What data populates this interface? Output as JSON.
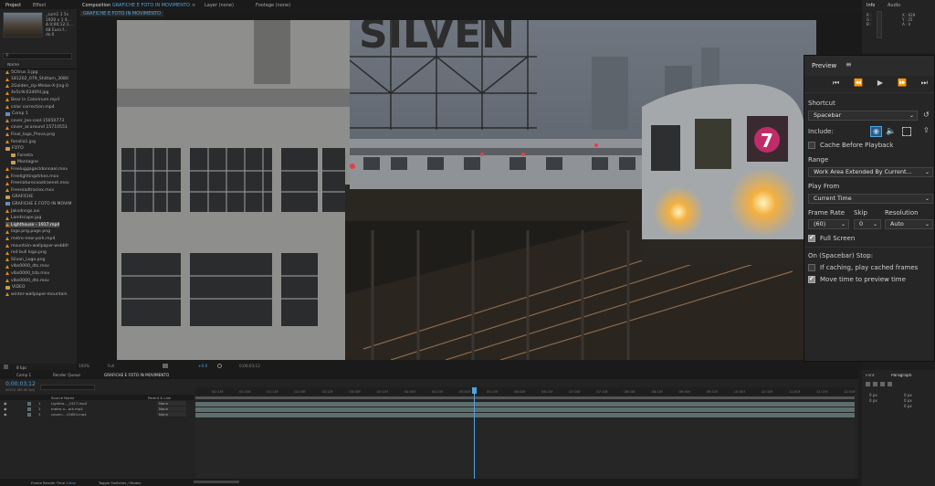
{
  "app": {
    "top_tabs": [
      "Project",
      "Effect",
      "Composition",
      "Layer (none)",
      "Footage (none)"
    ],
    "composition_tab": "GRAFICHE E FOTO IN MOVIMENTO",
    "composition_breadcrumb": "GRAFICHE E FOTO IN MOVIMENTO"
  },
  "project": {
    "title": "Project",
    "thumb_info": [
      "_sum1 1 5s",
      "1920 x 1 4...",
      "Δ 0;00;12;1...",
      "48 Euro f...",
      "ds.0"
    ],
    "search_placeholder": "",
    "column_name": "Name",
    "items": [
      {
        "label": "5Citrus 3.jpg",
        "kind": "cone",
        "indent": 0
      },
      {
        "label": "181202_079_Shittam_3080",
        "kind": "cone",
        "indent": 0
      },
      {
        "label": "2Golden_zip-Melan-X-Jing-0",
        "kind": "cone",
        "indent": 0
      },
      {
        "label": "4e5c9c02d0fd.jpg",
        "kind": "cone",
        "indent": 0
      },
      {
        "label": "Bear in Colorinum.mp4",
        "kind": "cone",
        "indent": 0
      },
      {
        "label": "color correction.mp4",
        "kind": "cone",
        "indent": 0
      },
      {
        "label": "Comp 1",
        "kind": "comp",
        "indent": 0
      },
      {
        "label": "cover_Joe-cool-15650773",
        "kind": "cone",
        "indent": 0
      },
      {
        "label": "cover_ar.around 15710551",
        "kind": "cone",
        "indent": 0
      },
      {
        "label": "Final_logo_Prova.png",
        "kind": "cone",
        "indent": 0
      },
      {
        "label": "fonolia1.jpg",
        "kind": "cone",
        "indent": 0
      },
      {
        "label": "FOTO",
        "kind": "folder",
        "indent": 0
      },
      {
        "label": "Foresta",
        "kind": "folder",
        "indent": 1
      },
      {
        "label": "Montagne",
        "kind": "folder",
        "indent": 1
      },
      {
        "label": "Freeluggagecldonnael.mov",
        "kind": "cone",
        "indent": 0
      },
      {
        "label": "Freelightingstrkes.mov",
        "kind": "cone",
        "indent": 0
      },
      {
        "label": "Freenaturecoastraenet.mov",
        "kind": "cone",
        "indent": 0
      },
      {
        "label": "Freeroadtraciex.mov",
        "kind": "cone",
        "indent": 0
      },
      {
        "label": "GRAFICHE",
        "kind": "folder",
        "indent": 0
      },
      {
        "label": "GRAFICHE E FOTO IN MOVIM",
        "kind": "comp",
        "indent": 0
      },
      {
        "label": "Jaksdnngs.avi",
        "kind": "cone",
        "indent": 0
      },
      {
        "label": "Landscape.jpg",
        "kind": "cone",
        "indent": 0
      },
      {
        "label": "Lighthouse - 1917.mp4",
        "kind": "cone",
        "indent": 0,
        "selected": true
      },
      {
        "label": "logo.png.page.png",
        "kind": "cone",
        "indent": 0
      },
      {
        "label": "metro-new-york.mp4",
        "kind": "cone",
        "indent": 0
      },
      {
        "label": "mountain-wallpaper-wxbbfr",
        "kind": "cone",
        "indent": 0
      },
      {
        "label": "red bull logo.png",
        "kind": "cone",
        "indent": 0
      },
      {
        "label": "Silvan_Logo.png",
        "kind": "cone",
        "indent": 0
      },
      {
        "label": "vlbs0000_dts.mov",
        "kind": "cone",
        "indent": 0
      },
      {
        "label": "vlbs0000_tda.mov",
        "kind": "cone",
        "indent": 0
      },
      {
        "label": "vlbs0000_dts.mov",
        "kind": "cone",
        "indent": 0
      },
      {
        "label": "VIDEO",
        "kind": "folder",
        "indent": 0
      },
      {
        "label": "winter-wallpaper-mountain",
        "kind": "cone",
        "indent": 0
      }
    ],
    "footer_bpc": "8 bpc"
  },
  "info_panel": {
    "tabs": [
      "Info",
      "Audio"
    ],
    "values": [
      "X : 629",
      "Y : 25",
      "R :",
      "G :",
      "B :",
      "A : 0"
    ],
    "audio_values": [
      "0.0",
      "-6.0",
      "-12.0",
      "-18.0",
      "-24.0"
    ]
  },
  "viewer": {
    "zoom": "100%",
    "quality": "Full",
    "timecode": "0;00;03;12",
    "exposure": "+0.0"
  },
  "preview": {
    "title": "Preview",
    "shortcut_label": "Shortcut",
    "shortcut_value": "Spacebar",
    "include_label": "Include:",
    "cache_before_playback": "Cache Before Playback",
    "cache_before_playback_checked": false,
    "range_label": "Range",
    "range_value": "Work Area Extended By Current...",
    "play_from_label": "Play From",
    "play_from_value": "Current Time",
    "frame_rate_label": "Frame Rate",
    "frame_rate_value": "(60)",
    "skip_label": "Skip",
    "skip_value": "0",
    "resolution_label": "Resolution",
    "resolution_value": "Auto",
    "full_screen": "Full Screen",
    "full_screen_checked": true,
    "on_stop_label": "On (Spacebar) Stop:",
    "if_caching": "If caching, play cached frames",
    "if_caching_checked": false,
    "move_time": "Move time to preview time",
    "move_time_checked": true
  },
  "timeline": {
    "tabs": [
      "Comp 1",
      "Render Queue",
      "GRAFICHE E FOTO IN MOVIMENTO"
    ],
    "timecode": "0;00;03;12",
    "timecode_sub": "00212 (60.00 fps)",
    "col_headers": {
      "source_name": "Source Name",
      "parent": "Parent & Link"
    },
    "layers": [
      {
        "num": "1",
        "name": "Lightho..._1917.mp4",
        "parent": "None"
      },
      {
        "num": "2",
        "name": "metro-n...ork.mp4",
        "parent": "None"
      },
      {
        "num": "3",
        "name": "coverr-...15650.mp4",
        "parent": "None"
      }
    ],
    "ticks": [
      "00:15f",
      "01:00f",
      "01:15f",
      "02:00f",
      "02:15f",
      "03:00f",
      "03:15f",
      "04:00f",
      "04:15f",
      "05:00f",
      "05:15f",
      "06:00f",
      "06:15f",
      "07:00f",
      "07:15f",
      "08:00f",
      "08:15f",
      "09:00f",
      "09:15f",
      "10:00f",
      "10:15f",
      "11:00f",
      "11:15f",
      "12:00f"
    ],
    "footer_render_time_label": "Frame Render Time",
    "footer_render_time": "14ms",
    "toggle_switches": "Toggle Switches / Modes"
  },
  "para_panel": {
    "tabs": [
      "Font",
      "Paragraph"
    ],
    "values": [
      "0 px",
      "0 px",
      "0 px",
      "0 px",
      "0 px"
    ]
  },
  "colors": {
    "accent": "#4fa3e0",
    "bg": "#1d1d1d",
    "panel": "#232323"
  }
}
